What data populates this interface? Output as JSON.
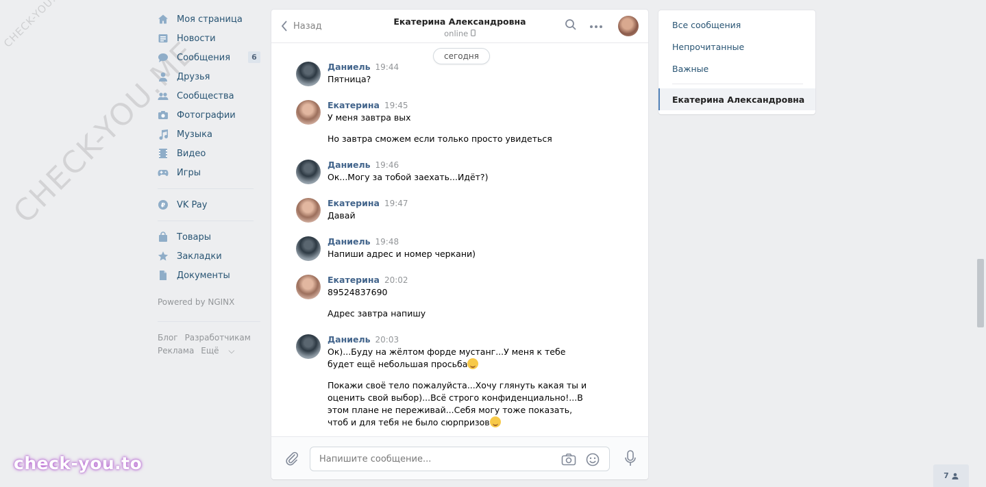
{
  "watermarks": {
    "small": "CHECK-YOU.ME",
    "big": "CHECK-YOU.ME",
    "bottom": "check-you.to"
  },
  "leftnav": {
    "items": [
      {
        "label": "Моя страница",
        "icon": "home-icon"
      },
      {
        "label": "Новости",
        "icon": "news-icon"
      },
      {
        "label": "Сообщения",
        "icon": "messages-icon",
        "badge": "6"
      },
      {
        "label": "Друзья",
        "icon": "friends-icon"
      },
      {
        "label": "Сообщества",
        "icon": "communities-icon"
      },
      {
        "label": "Фотографии",
        "icon": "camera-icon"
      },
      {
        "label": "Музыка",
        "icon": "music-icon"
      },
      {
        "label": "Видео",
        "icon": "video-icon"
      },
      {
        "label": "Игры",
        "icon": "games-icon"
      }
    ],
    "vkpay": {
      "label": "VK Pay",
      "icon": "vkpay-icon"
    },
    "items2": [
      {
        "label": "Товары",
        "icon": "bag-icon"
      },
      {
        "label": "Закладки",
        "icon": "star-icon"
      },
      {
        "label": "Документы",
        "icon": "document-icon"
      }
    ],
    "powered": "Powered by NGINX",
    "footer": {
      "blog": "Блог",
      "dev": "Разработчикам",
      "ads": "Реклама",
      "more": "Ещё"
    }
  },
  "chat": {
    "back_label": "Назад",
    "peer_name": "Екатерина Александровна",
    "peer_status": "online",
    "day_label": "сегодня",
    "messages": [
      {
        "author": "Даниель",
        "time": "19:44",
        "lines": [
          "Пятница?"
        ]
      },
      {
        "author": "Екатерина",
        "time": "19:45",
        "lines": [
          "У меня завтра вых",
          "Но завтра сможем если только просто увидеться"
        ]
      },
      {
        "author": "Даниель",
        "time": "19:46",
        "lines": [
          "Ок...Могу за тобой заехать...Идёт?)"
        ]
      },
      {
        "author": "Екатерина",
        "time": "19:47",
        "lines": [
          "Давай"
        ]
      },
      {
        "author": "Даниель",
        "time": "19:48",
        "lines": [
          "Напиши адрес и номер черкани)"
        ]
      },
      {
        "author": "Екатерина",
        "time": "20:02",
        "lines": [
          "89524837690",
          "Адрес завтра напишу"
        ]
      },
      {
        "author": "Даниель",
        "time": "20:03",
        "lines": [
          "Ок)...Буду на жёлтом форде мустанг...У меня к тебе будет ещё небольшая просьба",
          "Покажи своё тело пожалуйста...Хочу глянуть какая ты и оценить свой выбор)...Всё строго конфиденциально!...В этом плане не переживай...Себя могу тоже показать, чтоб и для тебя не было сюрпризов"
        ]
      }
    ],
    "composer_placeholder": "Напишите сообщение..."
  },
  "rightnav": {
    "all": "Все сообщения",
    "unread": "Непрочитанные",
    "important": "Важные",
    "active_chat": "Екатерина Александровна"
  },
  "online_count": "7"
}
